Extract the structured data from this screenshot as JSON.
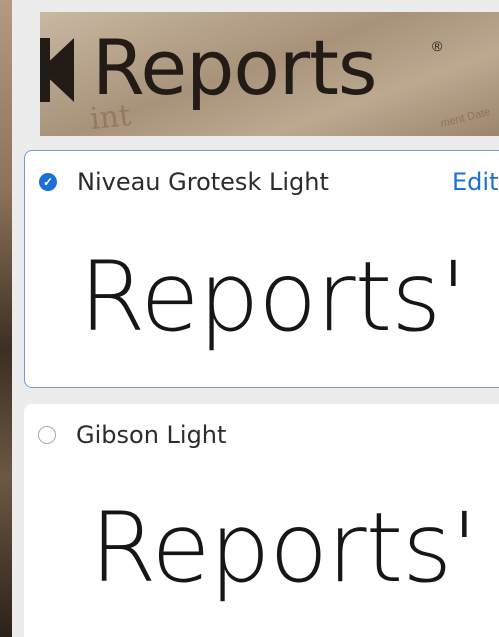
{
  "preview": {
    "logo_text": "Reports",
    "registered_mark": "®",
    "faint_text": "int",
    "faint_text_right": "ment Date"
  },
  "fonts": [
    {
      "name": "Niveau Grotesk Light",
      "selected": true,
      "edit_label": "Edit",
      "sample_text": "Reports'"
    },
    {
      "name": "Gibson Light",
      "selected": false,
      "sample_text": "Reports'"
    }
  ],
  "colors": {
    "accent": "#1b6fd8",
    "selected_border": "#6e9edb"
  },
  "icons": {
    "selected_radio": "check-circle-icon",
    "unselected_radio": "empty-circle-icon"
  }
}
